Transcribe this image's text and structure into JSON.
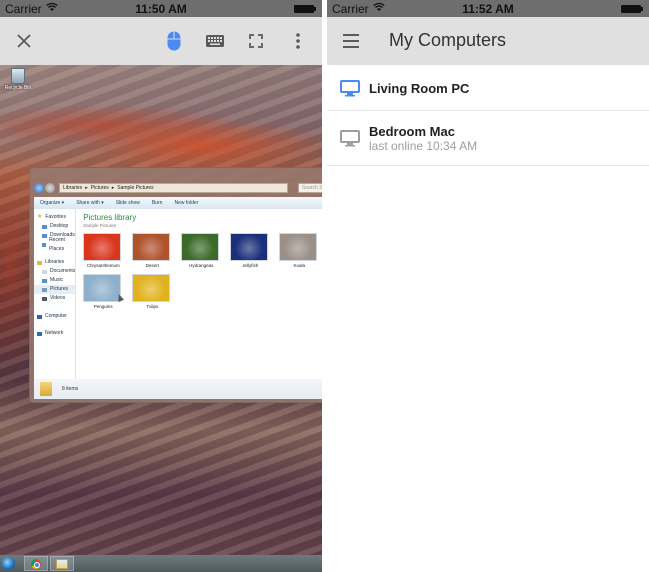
{
  "left_screen": {
    "status_bar": {
      "carrier": "Carrier",
      "time": "11:50 AM"
    },
    "toolbar": {
      "close_icon": "close-icon",
      "mouse_icon": "mouse-icon",
      "keyboard_icon": "keyboard-icon",
      "fullscreen_icon": "fullscreen-icon",
      "more_icon": "more-vertical-icon",
      "accent_color": "#4a8af4"
    },
    "remote_desktop": {
      "recycle_bin_label": "Recycle Bin",
      "explorer": {
        "breadcrumb": [
          "Libraries",
          "Pictures",
          "Sample Pictures"
        ],
        "search_placeholder": "Search Sa",
        "commands": [
          "Organize ▾",
          "Share with ▾",
          "Slide show",
          "Burn",
          "New folder"
        ],
        "nav": {
          "favorites": {
            "label": "Favorites",
            "items": [
              "Desktop",
              "Downloads",
              "Recent Places"
            ]
          },
          "libraries": {
            "label": "Libraries",
            "items": [
              "Documents",
              "Music",
              "Pictures",
              "Videos"
            ],
            "selected": "Pictures"
          },
          "computer": "Computer",
          "network": "Network"
        },
        "library_title": "Pictures library",
        "library_subtitle": "Sample Pictures",
        "pictures": [
          {
            "name": "Chrysanthemum",
            "color": "#d9361c"
          },
          {
            "name": "Desert",
            "color": "#b0522c"
          },
          {
            "name": "Hydrangeas",
            "color": "#3c6a2a"
          },
          {
            "name": "Jellyfish",
            "color": "#1c2f7a"
          },
          {
            "name": "Koala",
            "color": "#9a9088"
          },
          {
            "name": "Penguins",
            "color": "#8fb0cc"
          },
          {
            "name": "Tulips",
            "color": "#e2b21e"
          }
        ],
        "status": "8 items"
      }
    }
  },
  "right_screen": {
    "status_bar": {
      "carrier": "Carrier",
      "time": "11:52 AM"
    },
    "app_bar": {
      "title": "My Computers",
      "menu_icon": "hamburger-menu-icon"
    },
    "computers": [
      {
        "name": "Living Room PC",
        "status": "",
        "online": true,
        "icon_color": "#4a8af4"
      },
      {
        "name": "Bedroom Mac",
        "status": "last online 10:34 AM",
        "online": false,
        "icon_color": "#9e9e9e"
      }
    ]
  }
}
